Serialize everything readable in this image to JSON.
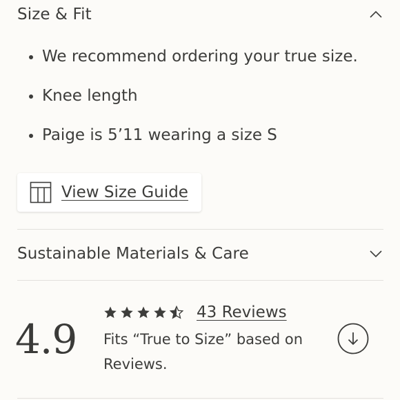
{
  "size_fit": {
    "title": "Size & Fit",
    "expanded": true,
    "bullets": [
      "We recommend ordering your true size.",
      "Knee length",
      "Paige is 5’11 wearing a size S"
    ],
    "size_guide_label": "View Size Guide"
  },
  "sustainable": {
    "title": "Sustainable Materials & Care",
    "expanded": false
  },
  "rating": {
    "average": "4.9",
    "stars": 4.5,
    "reviews_label": "43 Reviews",
    "fit_text": "Fits “True to Size” based on Reviews."
  },
  "icons": {
    "collapse": "chevron-up-icon",
    "expand": "chevron-down-icon",
    "size_guide": "table-icon",
    "jump": "arrow-down-circle-icon",
    "star": "star-icon"
  },
  "colors": {
    "text": "#3d3d3b",
    "background": "#fcfbf8",
    "divider": "#e2e0dc"
  }
}
